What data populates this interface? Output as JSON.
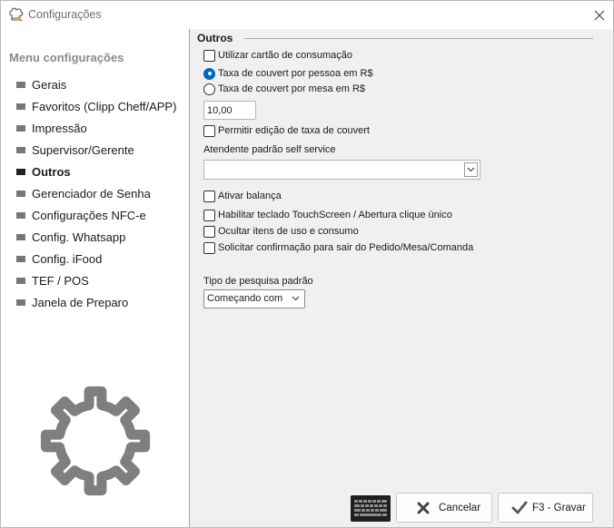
{
  "window": {
    "title": "Configurações"
  },
  "sidebar": {
    "heading": "Menu configurações",
    "items": [
      {
        "label": "Gerais"
      },
      {
        "label": "Favoritos (Clipp Cheff/APP)"
      },
      {
        "label": "Impressão"
      },
      {
        "label": "Supervisor/Gerente"
      },
      {
        "label": "Outros",
        "active": true
      },
      {
        "label": "Gerenciador de Senha"
      },
      {
        "label": "Configurações NFC-e"
      },
      {
        "label": "Config. Whatsapp"
      },
      {
        "label": "Config. iFood"
      },
      {
        "label": "TEF / POS"
      },
      {
        "label": "Janela de Preparo"
      }
    ]
  },
  "main": {
    "section_title": "Outros",
    "use_consumption_card": {
      "label": "Utilizar cartão de consumação",
      "checked": false
    },
    "couvert_per_person": {
      "label": "Taxa de couvert por pessoa em R$",
      "selected": true
    },
    "couvert_per_table": {
      "label": "Taxa de couvert por mesa em R$",
      "selected": false
    },
    "couvert_value": "10,00",
    "allow_edit_couvert": {
      "label": "Permitir edição de taxa de couvert",
      "checked": false
    },
    "default_attendant_label": "Atendente padrão self service",
    "default_attendant_value": "",
    "activate_scale": {
      "label": "Ativar balança",
      "checked": false
    },
    "touch_keyboard": {
      "label": "Habilitar teclado TouchScreen / Abertura clique único",
      "checked": false
    },
    "hide_usage_items": {
      "label": "Ocultar itens de uso e consumo",
      "checked": false
    },
    "confirm_exit": {
      "label": "Solicitar confirmação para sair do Pedido/Mesa/Comanda",
      "checked": false
    },
    "search_type_label": "Tipo de pesquisa padrão",
    "search_type_value": "Começando com"
  },
  "footer": {
    "cancel_label": "Cancelar",
    "save_label": "F3 - Gravar"
  },
  "colors": {
    "accent": "#0067c0",
    "panel_bg": "#f0f0f0",
    "sidebar_heading": "#8a8a8a"
  },
  "icons": {
    "app": "chef-hat-icon",
    "close": "close-icon",
    "keyboard": "keyboard-icon",
    "cancel": "x-mark-icon",
    "save": "checkmark-icon",
    "decor": "gear-icon"
  }
}
